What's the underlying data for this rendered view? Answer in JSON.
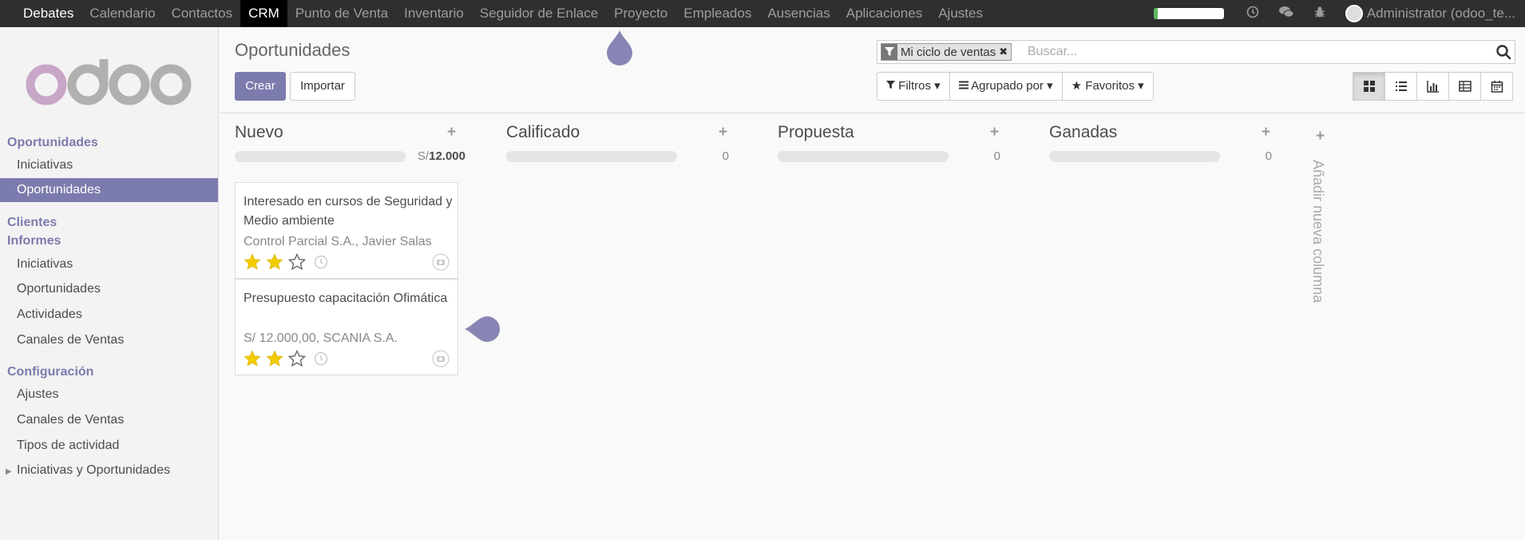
{
  "topbar": {
    "menu": [
      "Debates",
      "Calendario",
      "Contactos",
      "CRM",
      "Punto de Venta",
      "Inventario",
      "Seguidor de Enlace",
      "Proyecto",
      "Empleados",
      "Ausencias",
      "Aplicaciones",
      "Ajustes"
    ],
    "active": "CRM",
    "progress_fraction": 0.06,
    "user": "Administrator (odoo_te..."
  },
  "sidebar": {
    "sections": [
      {
        "title": "Oportunidades",
        "items": [
          "Iniciativas",
          "Oportunidades"
        ]
      },
      {
        "title": "Clientes",
        "items": []
      },
      {
        "title": "Informes",
        "items": [
          "Iniciativas",
          "Oportunidades",
          "Actividades",
          "Canales de Ventas"
        ]
      },
      {
        "title": "Configuración",
        "items": [
          "Ajustes",
          "Canales de Ventas",
          "Tipos de actividad",
          "Iniciativas y Oportunidades"
        ]
      }
    ],
    "active_item": "Oportunidades"
  },
  "control": {
    "title": "Oportunidades",
    "create": "Crear",
    "import": "Importar",
    "facet": "Mi ciclo de ventas",
    "search_placeholder": "Buscar...",
    "filters": "Filtros",
    "group_by": "Agrupado por",
    "favorites": "Favoritos"
  },
  "kanban": {
    "columns": [
      {
        "name": "Nuevo",
        "currency": "S/",
        "total": "12.000"
      },
      {
        "name": "Calificado",
        "total": "0"
      },
      {
        "name": "Propuesta",
        "total": "0"
      },
      {
        "name": "Ganadas",
        "total": "0"
      }
    ],
    "cards": [
      {
        "title": "Interesado en cursos de Seguridad y Medio ambiente",
        "subtitle": "Control Parcial S.A., Javier Salas",
        "stars": 2
      },
      {
        "title": "Presupuesto capacitación Ofimática",
        "subtitle": "S/ 12.000,00, SCANIA S.A.",
        "stars": 2
      }
    ],
    "add_column": "Añadir nueva columna"
  },
  "colors": {
    "accent": "#7c7bad",
    "navbar": "#2f2f2f",
    "star": "#f3cc00"
  }
}
